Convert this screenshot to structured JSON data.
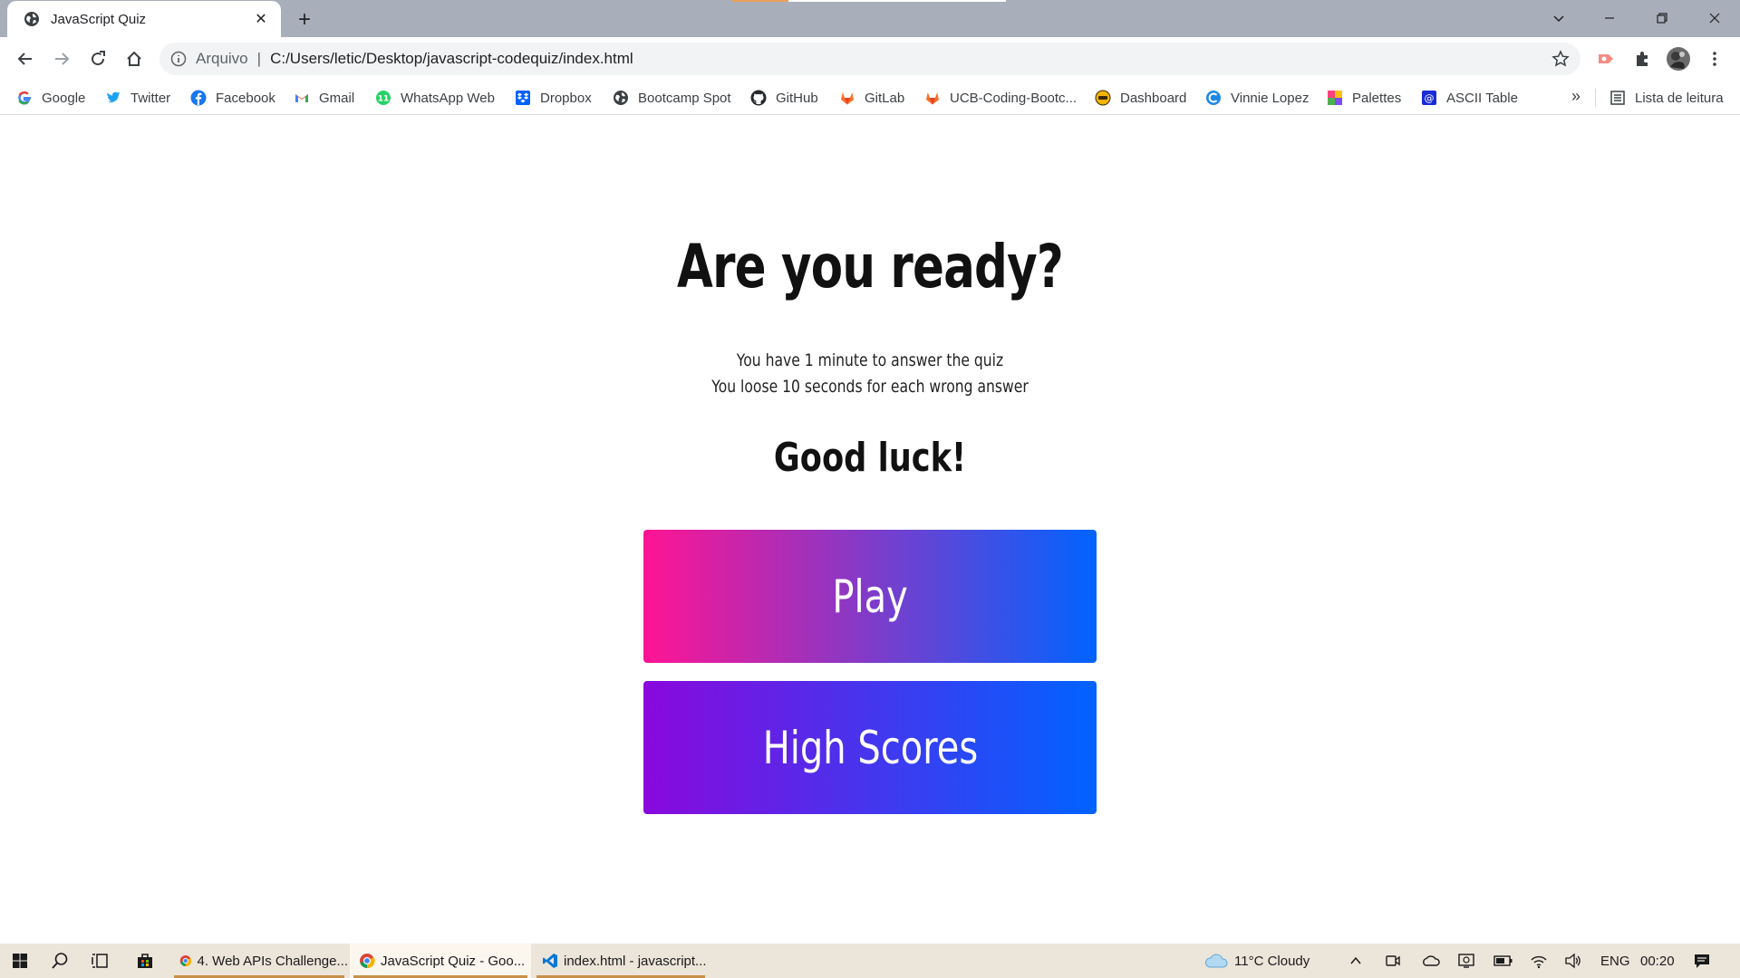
{
  "browser": {
    "tab": {
      "title": "JavaScript Quiz",
      "close": "✕"
    },
    "new_tab": "+",
    "window_controls": {
      "tab_search": "⌄",
      "minimize": "–",
      "restore": "❐",
      "close": "✕"
    },
    "address": {
      "scheme": "Arquivo",
      "separator": "|",
      "url": "C:/Users/letic/Desktop/javascript-codequiz/index.html"
    },
    "bookmarks": [
      {
        "label": "Google",
        "icon": "google-icon"
      },
      {
        "label": "Twitter",
        "icon": "twitter-icon"
      },
      {
        "label": "Facebook",
        "icon": "facebook-icon"
      },
      {
        "label": "Gmail",
        "icon": "gmail-icon"
      },
      {
        "label": "WhatsApp Web",
        "icon": "whatsapp-icon"
      },
      {
        "label": "Dropbox",
        "icon": "dropbox-icon"
      },
      {
        "label": "Bootcamp Spot",
        "icon": "globe-icon"
      },
      {
        "label": "GitHub",
        "icon": "github-icon"
      },
      {
        "label": "GitLab",
        "icon": "gitlab-icon"
      },
      {
        "label": "UCB-Coding-Bootc...",
        "icon": "gitlab-icon"
      },
      {
        "label": "Dashboard",
        "icon": "dashboard-icon"
      },
      {
        "label": "Vinnie Lopez",
        "icon": "circle-c-icon"
      },
      {
        "label": "Palettes",
        "icon": "palette-icon"
      },
      {
        "label": "ASCII Table",
        "icon": "at-icon"
      }
    ],
    "bookmarks_more": "»",
    "reading_list": "Lista de leitura"
  },
  "page": {
    "headline": "Are you ready?",
    "instructions": [
      "You have 1 minute to answer the quiz",
      "You loose 10 seconds for each wrong answer"
    ],
    "good_luck": "Good luck!",
    "play_button": "Play",
    "high_scores_button": "High Scores"
  },
  "colors": {
    "play_gradient_start": "#ff1493",
    "play_gradient_end": "#0063ff",
    "scores_gradient_start": "#8a08dc",
    "scores_gradient_end": "#0063ff",
    "tabstrip": "#a8aeba",
    "taskbar": "#ece5da"
  },
  "taskbar": {
    "apps": [
      {
        "label": "4. Web APIs Challenge...",
        "icon": "chrome-icon"
      },
      {
        "label": "JavaScript Quiz - Goo...",
        "icon": "chrome-icon"
      },
      {
        "label": "index.html - javascript...",
        "icon": "vscode-icon"
      }
    ],
    "weather": "11°C  Cloudy",
    "language": "ENG",
    "time": "00:20"
  }
}
